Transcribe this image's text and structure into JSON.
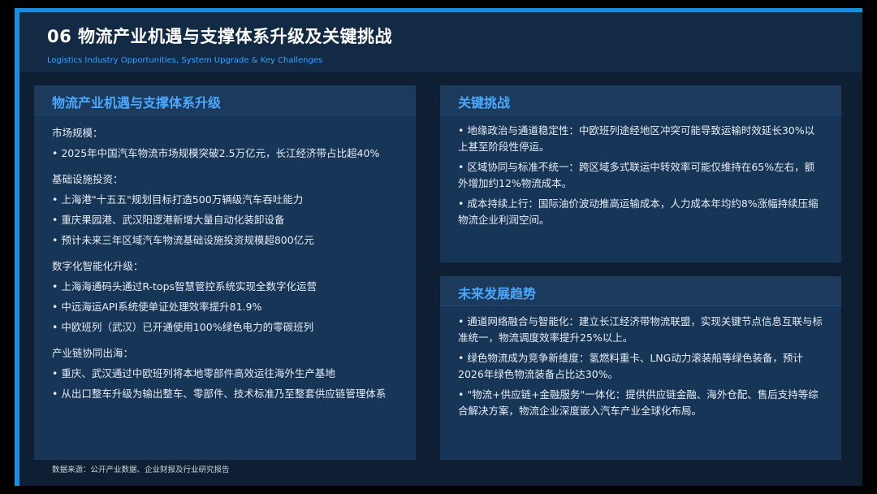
{
  "header": {
    "title": "06  物流产业机遇与支撑体系升级及关键挑战",
    "subtitle": "Logistics Industry Opportunities, System Upgrade & Key Challenges"
  },
  "left_panel": {
    "title": "物流产业机遇与支撑体系升级",
    "sections": [
      {
        "heading": "市场规模：",
        "items": [
          "• 2025年中国汽车物流市场规模突破2.5万亿元，长江经济带占比超40%"
        ]
      },
      {
        "heading": "基础设施投资：",
        "items": [
          "• 上海港\"十五五\"规划目标打造500万辆级汽车吞吐能力",
          "• 重庆果园港、武汉阳逻港新增大量自动化装卸设备",
          "• 预计未来三年区域汽车物流基础设施投资规模超800亿元"
        ]
      },
      {
        "heading": "数字化智能化升级：",
        "items": [
          "• 上海海通码头通过R-tops智慧管控系统实现全数字化运营",
          "• 中远海运API系统使单证处理效率提升81.9%",
          "• 中欧班列（武汉）已开通使用100%绿色电力的零碳班列"
        ]
      },
      {
        "heading": "产业链协同出海：",
        "items": [
          "• 重庆、武汉通过中欧班列将本地零部件高效运往海外生产基地",
          "• 从出口整车升级为输出整车、零部件、技术标准乃至整套供应链管理体系"
        ]
      }
    ]
  },
  "challenges_panel": {
    "title": "关键挑战",
    "items": [
      "• 地缘政治与通道稳定性：中欧班列途经地区冲突可能导致运输时效延长30%以上甚至阶段性停运。",
      "• 区域协同与标准不统一：跨区域多式联运中转效率可能仅维持在65%左右，额外增加约12%物流成本。",
      "• 成本持续上行：国际油价波动推高运输成本，人力成本年均约8%涨幅持续压缩物流企业利润空间。"
    ]
  },
  "trends_panel": {
    "title": "未来发展趋势",
    "items": [
      "• 通道网络融合与智能化：建立长江经济带物流联盟，实现关键节点信息互联与标准统一，物流调度效率提升25%以上。",
      "• 绿色物流成为竞争新维度：氢燃料重卡、LNG动力滚装船等绿色装备，预计2026年绿色物流装备占比达30%。",
      "• \"物流+供应链+金融服务\"一体化：提供供应链金融、海外仓配、售后支持等综合解决方案，物流企业深度嵌入汽车产业全球化布局。"
    ]
  },
  "footer": "数据来源：公开产业数据、企业财报及行业研究报告"
}
